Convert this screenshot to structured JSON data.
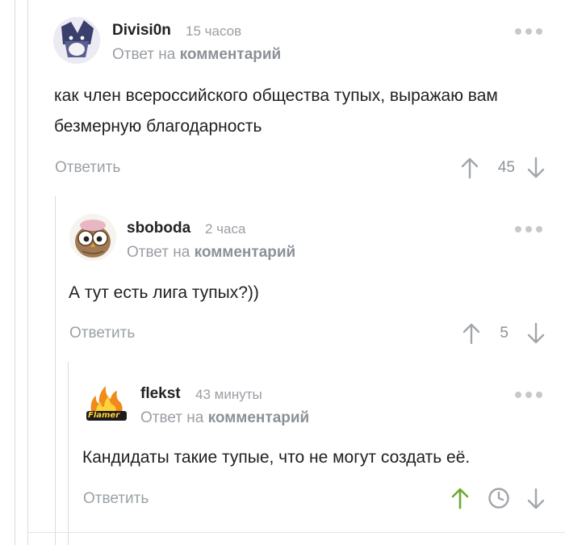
{
  "comments": [
    {
      "author": "Divisi0n",
      "time": "15 часов",
      "reply_prefix": "Ответ на",
      "reply_link": "комментарий",
      "text": "как член всероссийского общества тупых, выражаю вам безмерную благодарность",
      "reply_label": "Ответить",
      "rating": "45"
    },
    {
      "author": "sboboda",
      "time": "2 часа",
      "reply_prefix": "Ответ на",
      "reply_link": "комментарий",
      "text": "А тут есть лига тупых?))",
      "reply_label": "Ответить",
      "rating": "5"
    },
    {
      "author": "flekst",
      "time": "43 минуты",
      "reply_prefix": "Ответ на",
      "reply_link": "комментарий",
      "text": "Кандидаты такие тупые, что не могут создать её.",
      "reply_label": "Ответить",
      "rating_hidden": true
    }
  ],
  "avatar_texts": {
    "flekst_logo": "Flamer"
  },
  "colors": {
    "upvote_active": "#6aaa33",
    "muted": "#9a9ea3",
    "thread_line": "#dcdcdc"
  },
  "icons": [
    "more-dots-icon",
    "upvote-arrow-icon",
    "downvote-arrow-icon",
    "clock-icon"
  ]
}
